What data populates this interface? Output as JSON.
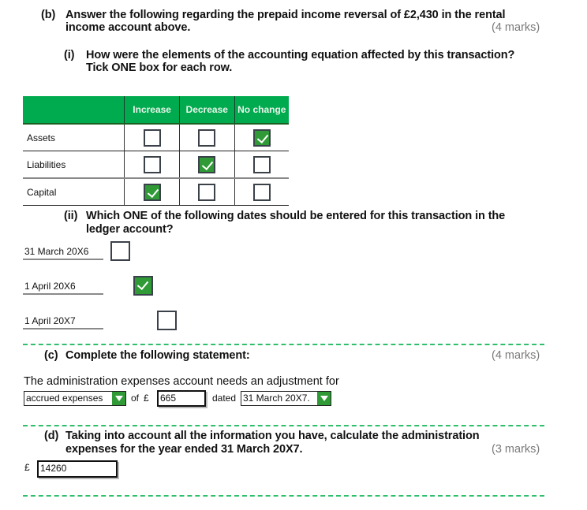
{
  "part_b": {
    "label": "(b)",
    "question_line1": "Answer the following regarding the prepaid income reversal of £2,430 in the rental",
    "question_line2": "income account above.",
    "marks": "(4 marks)",
    "sub_i": {
      "label": "(i)",
      "line1": "How were the elements of the accounting equation affected by this transaction?",
      "line2": "Tick ONE box for each row.",
      "columns": [
        "Increase",
        "Decrease",
        "No change"
      ],
      "rows": [
        {
          "label": "Assets",
          "checked": [
            false,
            false,
            true
          ]
        },
        {
          "label": "Liabilities",
          "checked": [
            false,
            true,
            false
          ]
        },
        {
          "label": "Capital",
          "checked": [
            true,
            false,
            false
          ]
        }
      ]
    },
    "sub_ii": {
      "label": "(ii)",
      "line1": "Which ONE of the following dates should be entered for this transaction in the",
      "line2": "ledger account?",
      "options": [
        {
          "label": "31 March 20X6",
          "checked": false
        },
        {
          "label": "1 April 20X6",
          "checked": true
        },
        {
          "label": "1 April 20X7",
          "checked": false
        }
      ]
    }
  },
  "part_c": {
    "label": "(c)",
    "question": "Complete the following statement:",
    "marks": "(4 marks)",
    "statement": "The administration expenses account needs an adjustment for",
    "adjustment_select": "accrued expenses",
    "of_text": "of",
    "currency": "£",
    "amount_value": "665",
    "dated_text": "dated",
    "date_select": "31 March 20X7."
  },
  "part_d": {
    "label": "(d)",
    "line1": "Taking into account all the information you have, calculate the administration",
    "line2": "expenses for the year ended 31 March 20X7.",
    "marks": "(3 marks)",
    "currency": "£",
    "answer_value": "14260"
  },
  "colors": {
    "accent_green": "#00aa4f",
    "checkbox_green": "#2f9a36",
    "dash_green": "#2fbf6b",
    "marks_gray": "#7a7a7a"
  }
}
